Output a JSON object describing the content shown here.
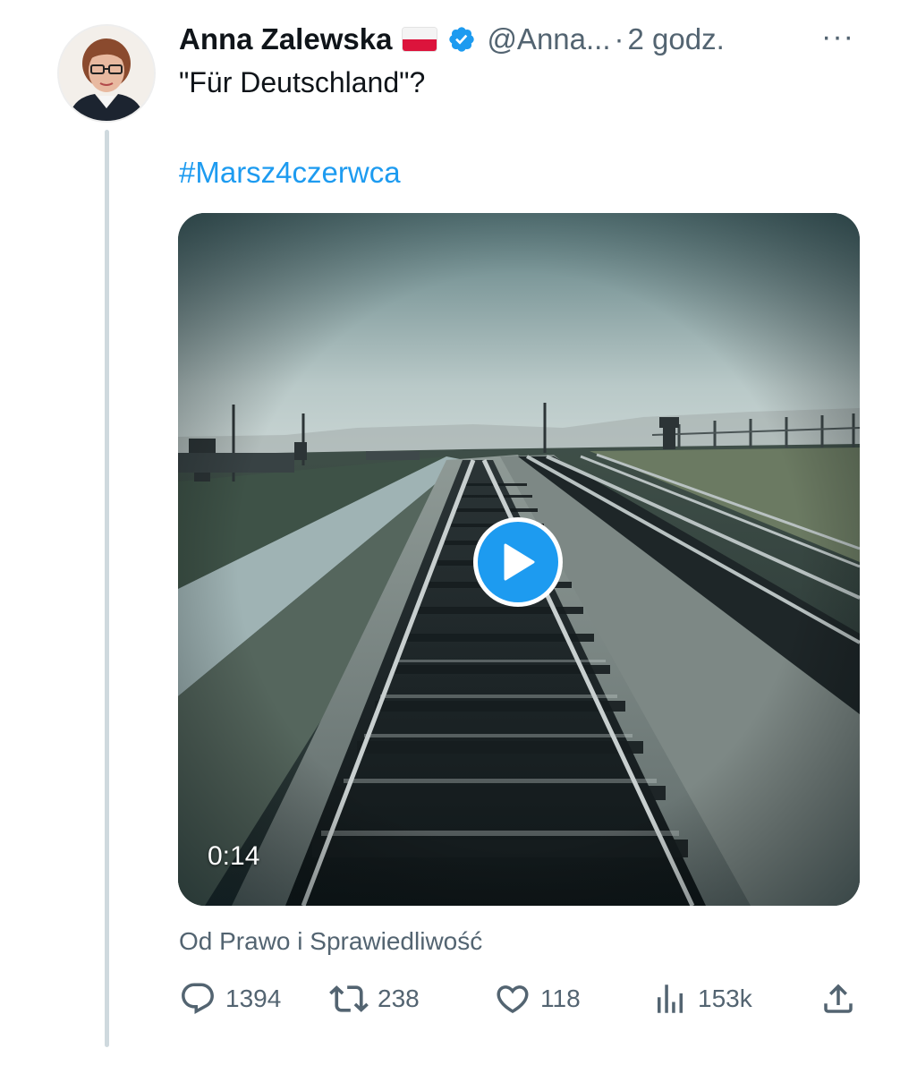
{
  "author": {
    "name": "Anna Zalewska",
    "flag_icon": "poland-flag-icon",
    "verified_icon": "verified-badge-icon",
    "handle": "@Anna...",
    "separator": "·",
    "time": "2 godz."
  },
  "more_label": "···",
  "tweet": {
    "text": "\"Für Deutschland\"?",
    "hashtag": "#Marsz4czerwca"
  },
  "media": {
    "type": "video",
    "duration": "0:14",
    "play_icon": "play-icon"
  },
  "attribution": "Od Prawo i Sprawiedliwość",
  "actions": {
    "reply": {
      "icon": "reply-icon",
      "count": "1394"
    },
    "retweet": {
      "icon": "retweet-icon",
      "count": "238"
    },
    "like": {
      "icon": "heart-icon",
      "count": "118"
    },
    "views": {
      "icon": "views-icon",
      "count": "153k"
    },
    "share": {
      "icon": "share-icon"
    }
  },
  "colors": {
    "accent": "#1d9bf0",
    "text_primary": "#0f1419",
    "text_secondary": "#536471",
    "thread_line": "#cfd9de"
  }
}
